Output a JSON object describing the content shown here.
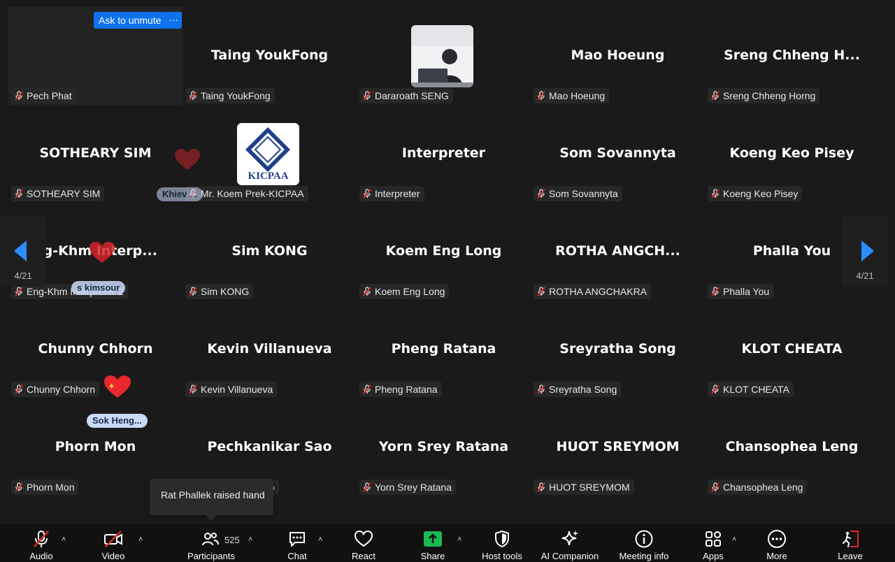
{
  "grid": {
    "tiles": [
      {
        "label": "Pech Phat"
      },
      {
        "big": "Taing YoukFong",
        "label": "Taing YoukFong"
      },
      {
        "label": "Dararoath SENG"
      },
      {
        "big": "Mao Hoeung",
        "label": "Mao Hoeung"
      },
      {
        "big": "Sreng Chheng H...",
        "label": "Sreng Chheng Horng"
      },
      {
        "big": "SOTHEARY SIM",
        "label": "SOTHEARY SIM"
      },
      {
        "label": "Mr. Koem Prek-KICPAA"
      },
      {
        "big": "Interpreter",
        "label": "Interpreter"
      },
      {
        "big": "Som Sovannyta",
        "label": "Som Sovannyta"
      },
      {
        "big": "Koeng Keo Pisey",
        "label": "Koeng Keo Pisey"
      },
      {
        "big": "ng-Khm Interp...",
        "label": "Eng-Khm Interpreter 2"
      },
      {
        "big": "Sim KONG",
        "label": "Sim KONG"
      },
      {
        "big": "Koem Eng Long",
        "label": "Koem Eng Long"
      },
      {
        "big": "ROTHA ANGCH...",
        "label": "ROTHA ANGCHAKRA"
      },
      {
        "big": "Phalla You",
        "label": "Phalla You"
      },
      {
        "big": "Chunny Chhorn",
        "label": "Chunny Chhorn"
      },
      {
        "big": "Kevin Villanueva",
        "label": "Kevin Villanueva"
      },
      {
        "big": "Pheng Ratana",
        "label": "Pheng Ratana"
      },
      {
        "big": "Sreyratha Song",
        "label": "Sreyratha Song"
      },
      {
        "big": "KLOT CHEATA",
        "label": "KLOT CHEATA"
      },
      {
        "big": "Phorn Mon",
        "label": "Phorn Mon"
      },
      {
        "big": "Pechkanikar Sao",
        "label": "Pechkanikar Sao"
      },
      {
        "big": "Yorn Srey Ratana",
        "label": "Yorn Srey Ratana"
      },
      {
        "big": "HUOT SREYMOM",
        "label": "HUOT SREYMOM"
      },
      {
        "big": "Chansophea Leng",
        "label": "Chansophea Leng"
      }
    ]
  },
  "ask_unmute": "Ask to unmute",
  "more_dots": "···",
  "kicpaa_logo_text": "KICPAA",
  "pager": {
    "left": "4/21",
    "right": "4/21"
  },
  "reactions": {
    "bubble_1": "Khiev ...",
    "bubble_2": "s kimsour",
    "bubble_3": "Sok  Heng..."
  },
  "toast": "Rat Phallek raised hand",
  "toolbar": {
    "audio": "Audio",
    "video": "Video",
    "participants": "Participants",
    "participants_count": "525",
    "chat": "Chat",
    "react": "React",
    "share": "Share",
    "host_tools": "Host tools",
    "ai_companion": "AI Companion",
    "meeting_info": "Meeting info",
    "apps": "Apps",
    "more": "More",
    "leave": "Leave"
  },
  "colors": {
    "accent": "#0e72ed",
    "share_green": "#1db954",
    "leave_red": "#e02828",
    "muted_red": "#e02828"
  }
}
